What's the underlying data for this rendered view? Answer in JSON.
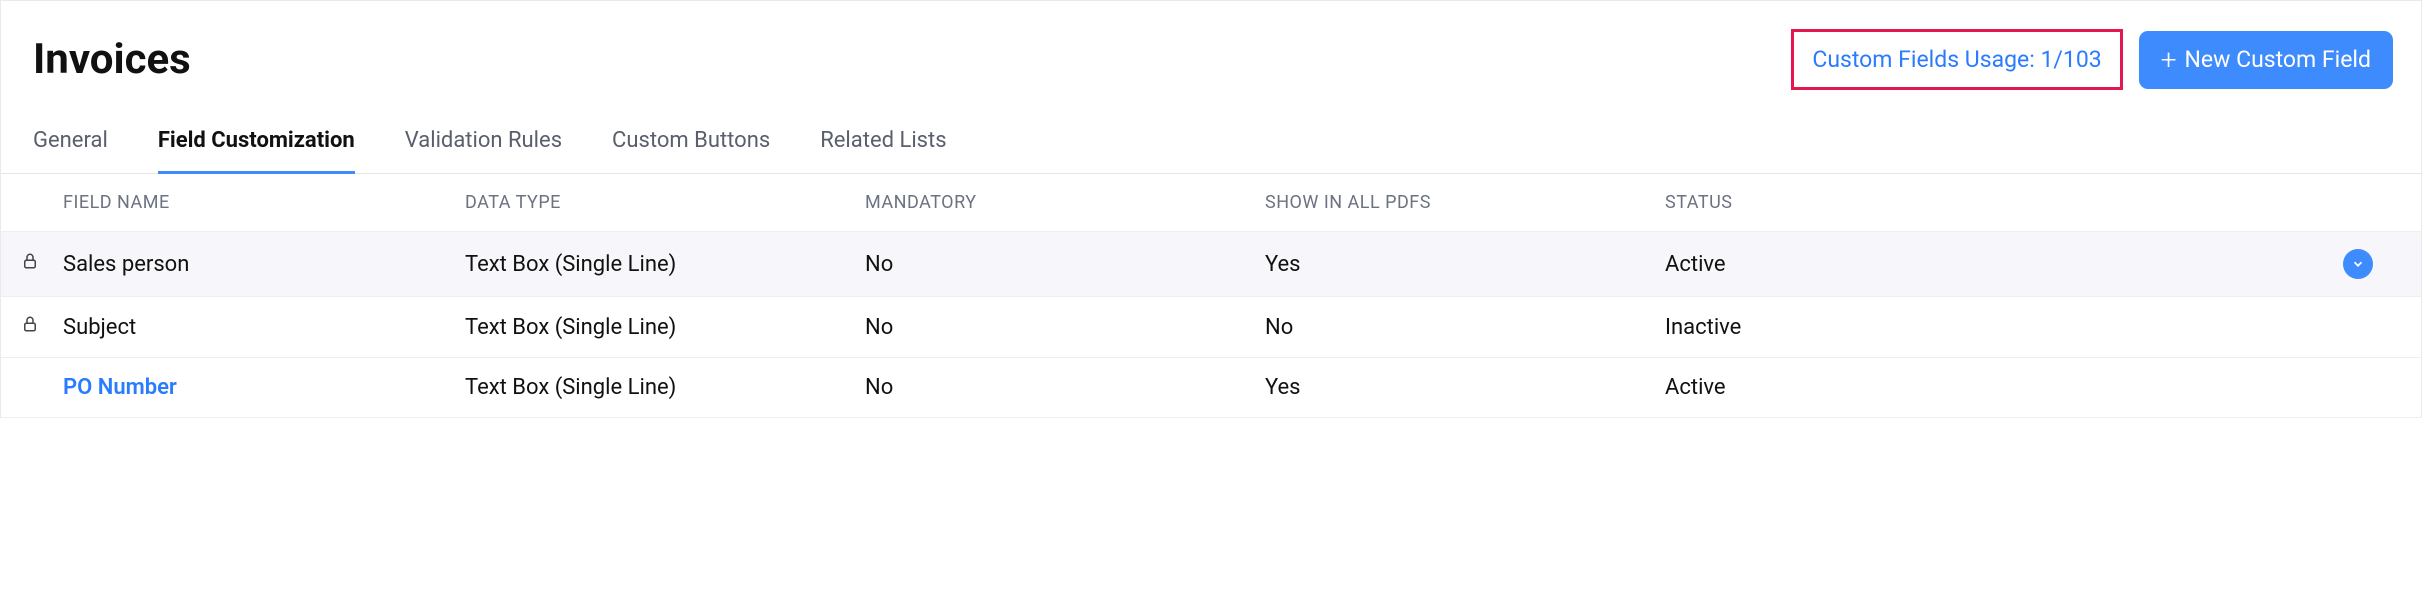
{
  "header": {
    "title": "Invoices",
    "usage_label": "Custom Fields Usage: 1/103",
    "new_button": "New Custom Field"
  },
  "tabs": {
    "general": "General",
    "field_customization": "Field Customization",
    "validation_rules": "Validation Rules",
    "custom_buttons": "Custom Buttons",
    "related_lists": "Related Lists"
  },
  "table": {
    "headers": {
      "field_name": "FIELD NAME",
      "data_type": "DATA TYPE",
      "mandatory": "MANDATORY",
      "show_in_all_pdfs": "SHOW IN ALL PDFS",
      "status": "STATUS"
    },
    "rows": [
      {
        "locked": true,
        "field_name": "Sales person",
        "data_type": "Text Box (Single Line)",
        "mandatory": "No",
        "show_in_pdfs": "Yes",
        "status": "Active",
        "hovered": true,
        "is_link": false
      },
      {
        "locked": true,
        "field_name": "Subject",
        "data_type": "Text Box (Single Line)",
        "mandatory": "No",
        "show_in_pdfs": "No",
        "status": "Inactive",
        "hovered": false,
        "is_link": false
      },
      {
        "locked": false,
        "field_name": "PO Number",
        "data_type": "Text Box (Single Line)",
        "mandatory": "No",
        "show_in_pdfs": "Yes",
        "status": "Active",
        "hovered": false,
        "is_link": true
      }
    ]
  }
}
